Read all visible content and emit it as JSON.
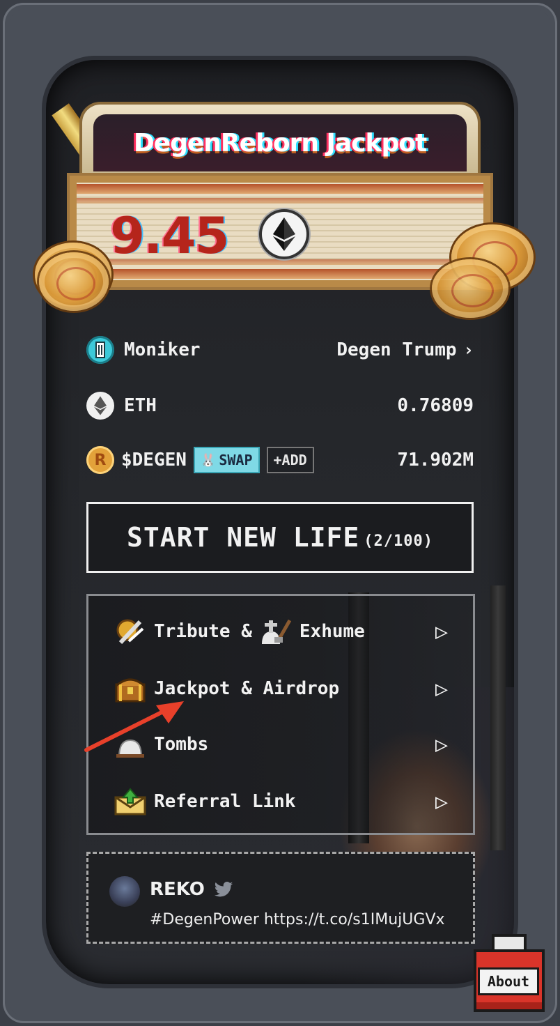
{
  "jackpot": {
    "title": "DegenReborn Jackpot",
    "amount": "9.45"
  },
  "wallet": {
    "moniker_label": "Moniker",
    "moniker_value": "Degen Trump",
    "eth_label": "ETH",
    "eth_value": "0.76809",
    "degen_label": "$DEGEN",
    "swap_label": "SWAP",
    "add_label": "+ADD",
    "degen_value": "71.902M"
  },
  "start": {
    "label": "START NEW LIFE",
    "count": "(2/100)"
  },
  "menu": {
    "items": [
      {
        "label_a": "Tribute &",
        "label_b": "Exhume"
      },
      {
        "label": "Jackpot & Airdrop"
      },
      {
        "label": "Tombs"
      },
      {
        "label": "Referral Link"
      }
    ]
  },
  "tweet": {
    "name": "REKO",
    "text": "#DegenPower https://t.co/s1IMujUGVx"
  },
  "about": {
    "label": "About"
  },
  "colors": {
    "accent_red": "#b5251b",
    "swap_cyan": "#7fd9e6",
    "annotation_arrow": "#e8402a"
  }
}
